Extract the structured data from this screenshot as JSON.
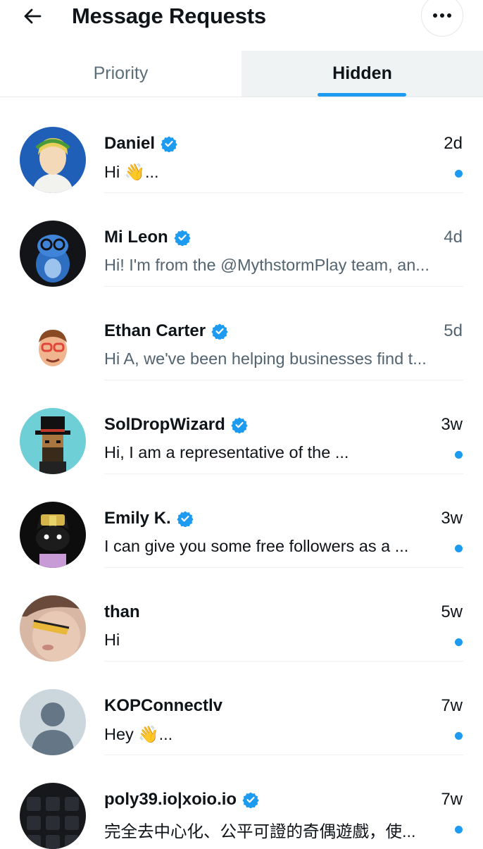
{
  "header": {
    "title": "Message Requests",
    "back_icon": "arrow-left-icon",
    "more_icon": "more-horizontal-icon"
  },
  "tabs": [
    {
      "label": "Priority",
      "active": false
    },
    {
      "label": "Hidden",
      "active": true
    }
  ],
  "colors": {
    "accent": "#1d9bf0",
    "text_primary": "#0f1419",
    "text_secondary": "#536471",
    "tab_active_bg": "#eff3f4"
  },
  "conversations": [
    {
      "name": "Daniel",
      "verified": true,
      "time": "2d",
      "message": "Hi 👋...",
      "unread": true
    },
    {
      "name": "Mi Leon",
      "verified": true,
      "time": "4d",
      "message": "Hi! I'm from the @MythstormPlay team, an...",
      "unread": false
    },
    {
      "name": "Ethan Carter",
      "verified": true,
      "time": "5d",
      "message": "Hi A, we've been helping businesses find t...",
      "unread": false
    },
    {
      "name": "SolDropWizard",
      "verified": true,
      "time": "3w",
      "message": "Hi, I am a representative of the ...",
      "unread": true
    },
    {
      "name": "Emily K.",
      "verified": true,
      "time": "3w",
      "message": "I can give you some free followers as a ...",
      "unread": true
    },
    {
      "name": "than",
      "verified": false,
      "time": "5w",
      "message": "Hi",
      "unread": true
    },
    {
      "name": "KOPConnectlv",
      "verified": false,
      "time": "7w",
      "message": "Hey 👋...",
      "unread": true
    },
    {
      "name": "poly39.io|xoio.io",
      "verified": true,
      "time": "7w",
      "message": "完全去中心化、公平可證的奇偶遊戲，使...",
      "unread": true
    }
  ]
}
